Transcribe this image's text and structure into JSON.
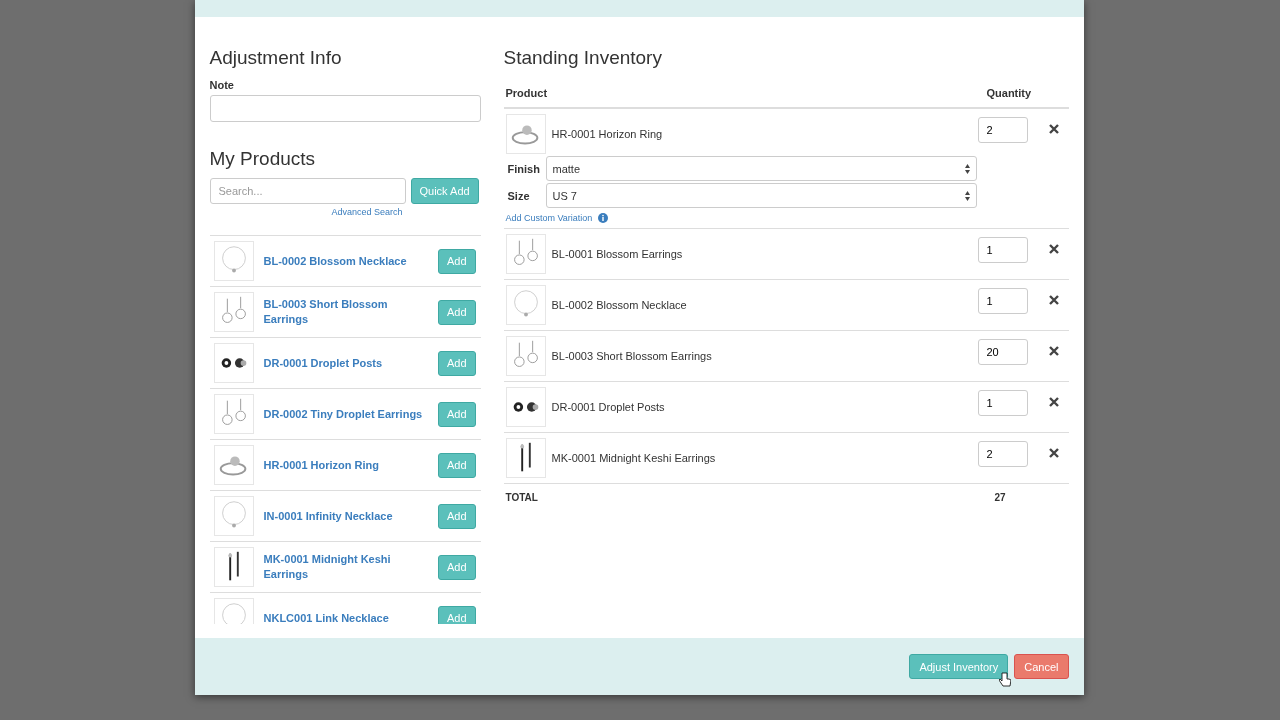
{
  "adjustment_info": {
    "title": "Adjustment Info",
    "note_label": "Note"
  },
  "my_products": {
    "title": "My Products",
    "search_placeholder": "Search...",
    "quick_add": "Quick Add",
    "advanced_search": "Advanced Search",
    "items": [
      {
        "name": "BL-0002 Blossom Necklace",
        "button": "Add"
      },
      {
        "name": "BL-0003 Short Blossom Earrings",
        "button": "Add"
      },
      {
        "name": "DR-0001 Droplet Posts",
        "button": "Add"
      },
      {
        "name": "DR-0002 Tiny Droplet Earrings",
        "button": "Add"
      },
      {
        "name": "HR-0001 Horizon Ring",
        "button": "Add"
      },
      {
        "name": "IN-0001 Infinity Necklace",
        "button": "Add"
      },
      {
        "name": "MK-0001 Midnight Keshi Earrings",
        "button": "Add"
      },
      {
        "name": "NKLC001 Link Necklace",
        "button": "Add"
      }
    ]
  },
  "standing_inventory": {
    "title": "Standing Inventory",
    "columns": [
      "Product",
      "Quantity"
    ],
    "rows": [
      {
        "name": "HR-0001 Horizon Ring",
        "quantity": "2",
        "variations": [
          {
            "label": "Finish",
            "value": "matte"
          },
          {
            "label": "Size",
            "value": "US 7"
          }
        ],
        "add_custom_variation": "Add Custom Variation"
      },
      {
        "name": "BL-0001 Blossom Earrings",
        "quantity": "1"
      },
      {
        "name": "BL-0002 Blossom Necklace",
        "quantity": "1"
      },
      {
        "name": "BL-0003 Short Blossom Earrings",
        "quantity": "20"
      },
      {
        "name": "DR-0001 Droplet Posts",
        "quantity": "1"
      },
      {
        "name": "MK-0001 Midnight Keshi Earrings",
        "quantity": "2"
      }
    ],
    "total_label": "TOTAL",
    "total": "27"
  },
  "footer": {
    "buttons": [
      {
        "label": "Adjust Inventory",
        "kind": "primary"
      },
      {
        "label": "Cancel",
        "kind": "danger"
      }
    ]
  }
}
